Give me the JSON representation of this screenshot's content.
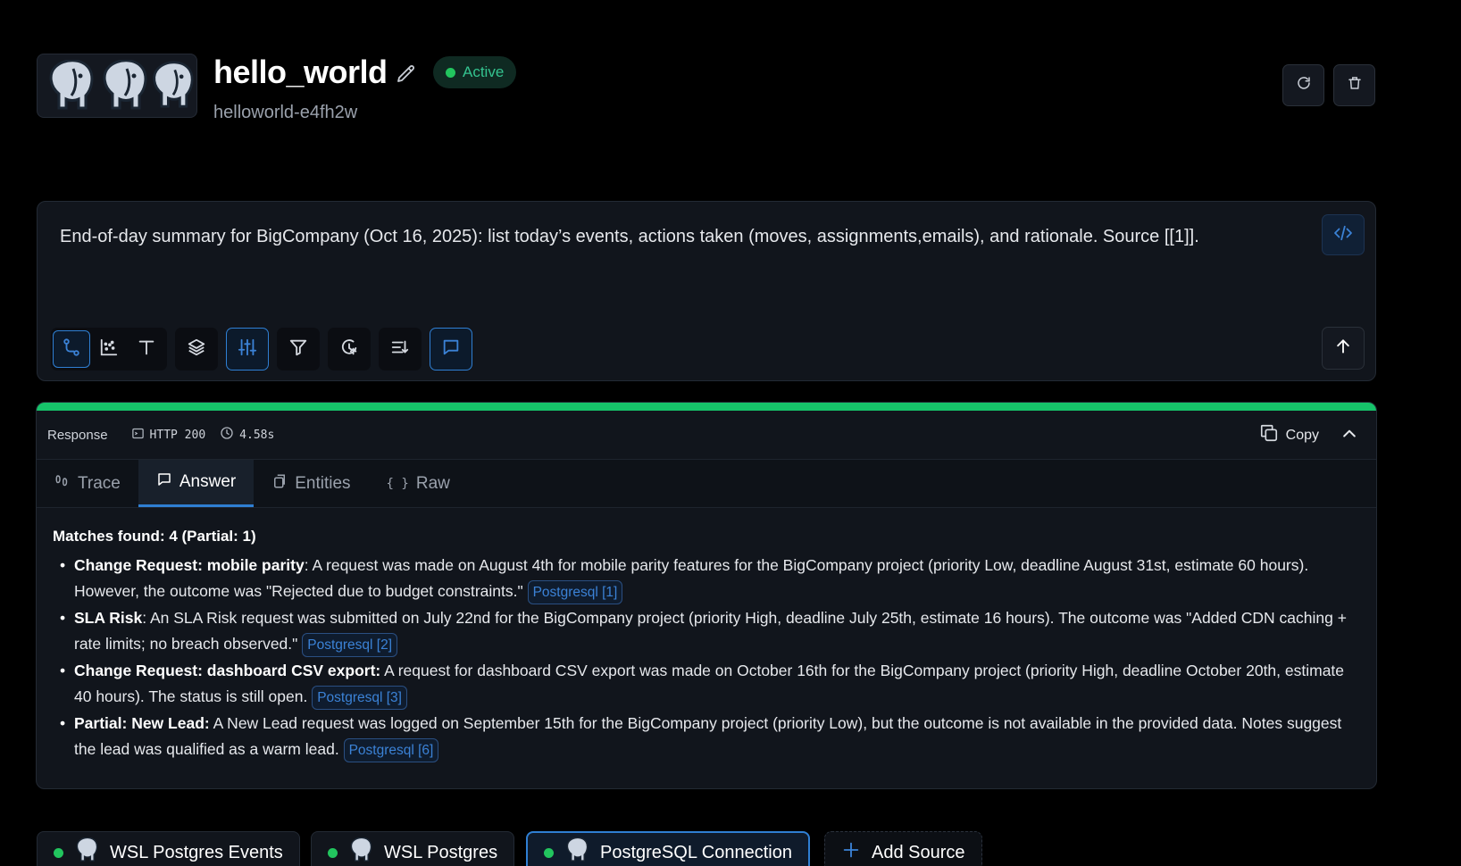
{
  "header": {
    "title": "hello_world",
    "status": "Active",
    "subtitle": "helloworld-e4fh2w"
  },
  "prompt": {
    "text": "End-of-day summary for BigCompany (Oct 16, 2025): list today’s events, actions taken (moves, assignments,emails), and rationale. Source [[1]]."
  },
  "toolbar": {
    "icons": [
      "flow-icon",
      "scatter-icon",
      "text-icon",
      "layers-icon",
      "sliders-icon",
      "filter-icon",
      "history-icon",
      "sort-icon",
      "chat-icon"
    ]
  },
  "response": {
    "label": "Response",
    "http": "HTTP 200",
    "time": "4.58s",
    "copy_label": "Copy",
    "tabs": [
      {
        "label": "Trace"
      },
      {
        "label": "Answer"
      },
      {
        "label": "Entities"
      },
      {
        "label": "Raw"
      }
    ],
    "answer": {
      "matches": "Matches found: 4 (Partial: 1)",
      "items": [
        {
          "title": "Change Request: mobile parity",
          "text": ": A request was made on August 4th for mobile parity features for the BigCompany project (priority Low, deadline August 31st, estimate 60 hours). However, the outcome was \"Rejected due to budget constraints.\" ",
          "cite": "Postgresql [1]"
        },
        {
          "title": "SLA Risk",
          "text": ": An SLA Risk request was submitted on July 22nd for the BigCompany project (priority High, deadline July 25th, estimate 16 hours). The outcome was \"Added CDN caching + rate limits; no breach observed.\" ",
          "cite": "Postgresql [2]"
        },
        {
          "title": "Change Request: dashboard CSV export:",
          "text": " A request for dashboard CSV export was made on October 16th for the BigCompany project (priority High, deadline October 20th, estimate 40 hours). The status is still open. ",
          "cite": "Postgresql [3]"
        },
        {
          "title": "Partial: New Lead:",
          "text": " A New Lead request was logged on September 15th for the BigCompany project (priority Low), but the outcome is not available in the provided data. Notes suggest the lead was qualified as a warm lead. ",
          "cite": "Postgresql [6]"
        }
      ]
    }
  },
  "sources": [
    {
      "label": "WSL Postgres Events"
    },
    {
      "label": "WSL Postgres"
    },
    {
      "label": "PostgreSQL Connection"
    },
    {
      "label": "Add Source"
    }
  ],
  "colors": {
    "accent": "#2f7fd3",
    "success": "#16c36a",
    "background": "#000000"
  }
}
